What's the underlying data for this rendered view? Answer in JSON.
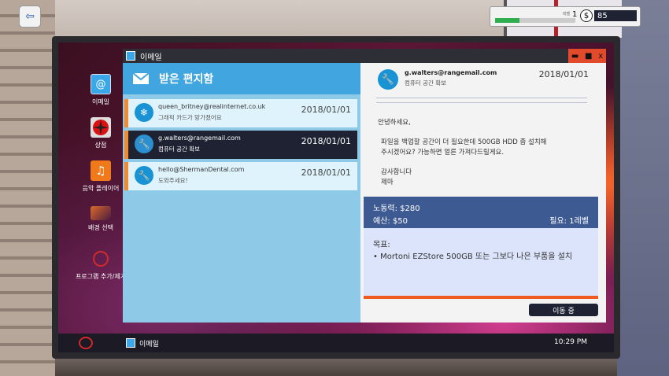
{
  "hud": {
    "level_label": "레벨",
    "level": "1",
    "money": "85",
    "coin_symbol": "$",
    "xp_progress": 0.3
  },
  "desktop": {
    "icons": [
      {
        "label": "이메일",
        "icon": "email-icon"
      },
      {
        "label": "상점",
        "icon": "shop-icon"
      },
      {
        "label": "음악 플레이어",
        "icon": "music-icon"
      },
      {
        "label": "배경 선택",
        "icon": "wallpaper-icon"
      },
      {
        "label": "프로그램 추가/제거",
        "icon": "programs-icon"
      }
    ]
  },
  "taskbar": {
    "email_label": "이메일",
    "clock": "10:29 PM"
  },
  "email_window": {
    "title": "이메일",
    "controls": {
      "close": "x",
      "maximize": "■",
      "minimize": "▬"
    },
    "inbox_title": "받은 편지함",
    "messages": [
      {
        "from": "queen_britney@realinternet.co.uk",
        "subject": "그래픽 카드가 망가졌어요",
        "date": "2018/01/01"
      },
      {
        "from": "g.walters@rangemail.com",
        "subject": "컴퓨터 공간 확보",
        "date": "2018/01/01"
      },
      {
        "from": "hello@ShermanDental.com",
        "subject": "도와주세요!",
        "date": "2018/01/01"
      }
    ],
    "reader": {
      "from": "g.walters@rangemail.com",
      "subject": "컴퓨터 공간 확보",
      "date": "2018/01/01",
      "greeting": "안녕하세요,",
      "body_line1": "파일을 백업할 공간이 더 필요한데 500GB HDD 좀 설치해",
      "body_line2": "주시겠어요? 가능하면 얼른 가져다드릴게요.",
      "closing": "감사합니다",
      "signature": "제마",
      "labor": "노동력: $280",
      "budget": "예산: $50",
      "required_level": "필요: 1레벨",
      "goal_title": "목표:",
      "goal_item": "• Mortoni EZStore 500GB 또는 그보다 나은 부품을 설치",
      "action_button": "이동 중"
    }
  },
  "colors": {
    "accent_blue": "#41a6e0",
    "accent_orange": "#f28b2f",
    "dark_navy": "#1e2233",
    "job_blue": "#3e5a92"
  }
}
